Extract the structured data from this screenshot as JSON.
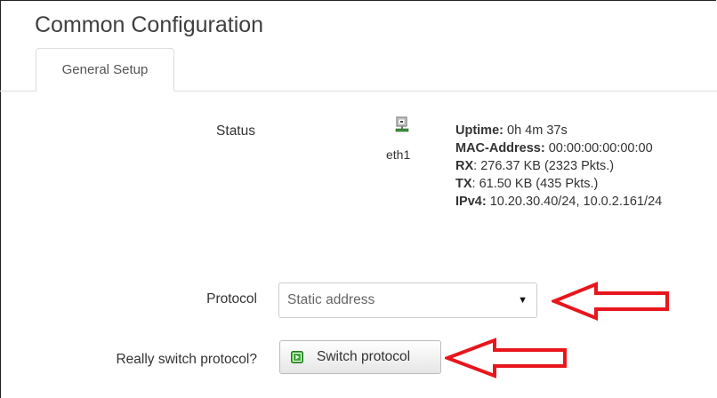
{
  "header": {
    "title": "Common Configuration"
  },
  "tabs": [
    {
      "label": "General Setup",
      "active": true
    }
  ],
  "status": {
    "label": "Status",
    "interface_icon": "network-interface-icon",
    "interface_name": "eth1",
    "lines": {
      "uptime_key": "Uptime:",
      "uptime_value": "0h 4m 37s",
      "mac_key": "MAC-Address:",
      "mac_value": "00:00:00:00:00:00",
      "rx_key": "RX",
      "rx_value": ": 276.37 KB (2323 Pkts.)",
      "tx_key": "TX",
      "tx_value": ": 61.50 KB (435 Pkts.)",
      "ipv4_key": "IPv4:",
      "ipv4_value": "10.20.30.40/24, 10.0.2.161/24"
    }
  },
  "protocol": {
    "label": "Protocol",
    "selected": "Static address"
  },
  "switch": {
    "label": "Really switch protocol?",
    "button_label": "Switch protocol",
    "button_icon": "apply-icon"
  },
  "colors": {
    "annotation_arrow": "#e8161c",
    "button_icon": "#3aa835"
  }
}
